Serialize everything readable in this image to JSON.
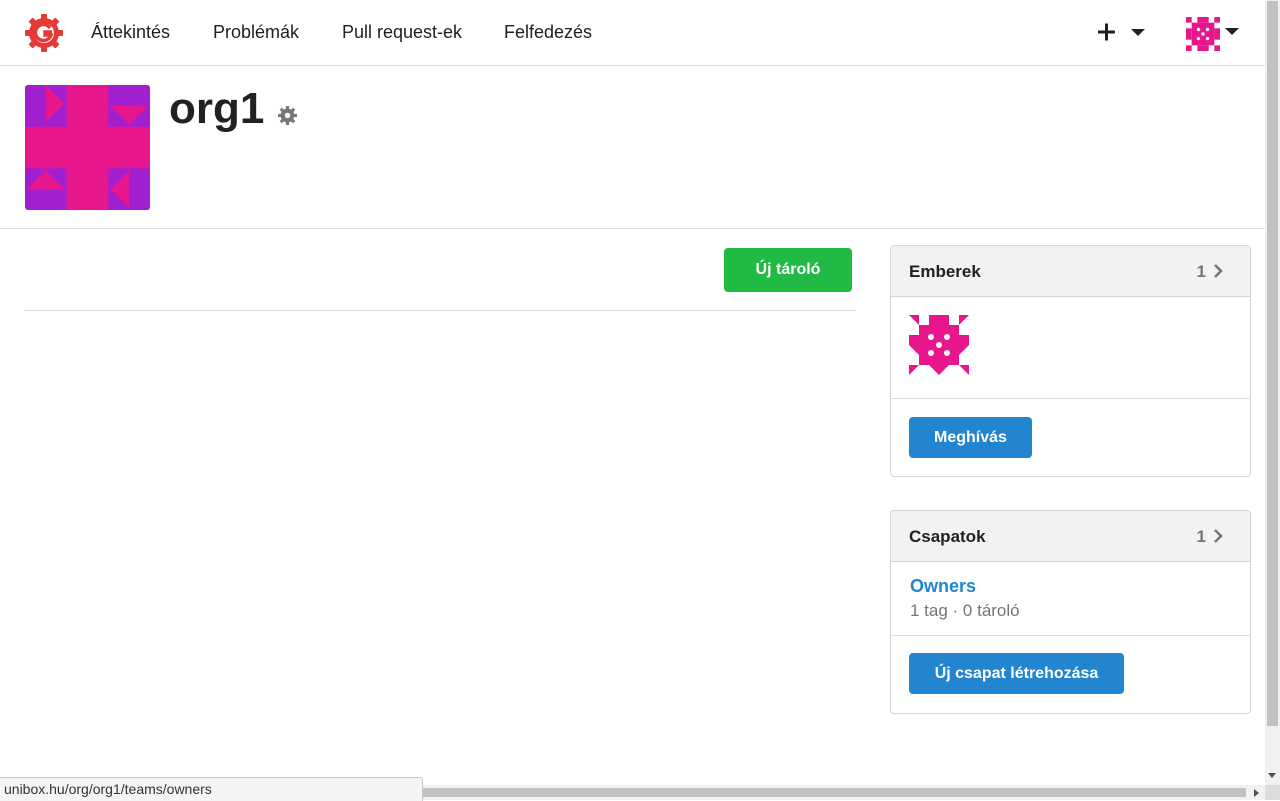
{
  "navbar": {
    "items": [
      {
        "label": "Áttekintés"
      },
      {
        "label": "Problémák"
      },
      {
        "label": "Pull request-ek"
      },
      {
        "label": "Felfedezés"
      }
    ],
    "plus_icon": "plus-icon",
    "caret_icon": "caret-down-icon"
  },
  "org": {
    "name": "org1",
    "settings_icon": "gear-icon"
  },
  "main": {
    "new_repo_label": "Új tároló"
  },
  "people": {
    "title": "Emberek",
    "count": "1",
    "invite_label": "Meghívás"
  },
  "teams": {
    "title": "Csapatok",
    "count": "1",
    "items": [
      {
        "name": "Owners",
        "meta": "1 tag · 0 tároló"
      }
    ],
    "create_label": "Új csapat létrehozása"
  },
  "status_bar": {
    "url": "unibox.hu/org/org1/teams/owners"
  },
  "colors": {
    "green_button": "#21ba45",
    "blue_button": "#2185d0",
    "avatar_magenta": "#e8168c",
    "avatar_purple": "#a020d0"
  }
}
